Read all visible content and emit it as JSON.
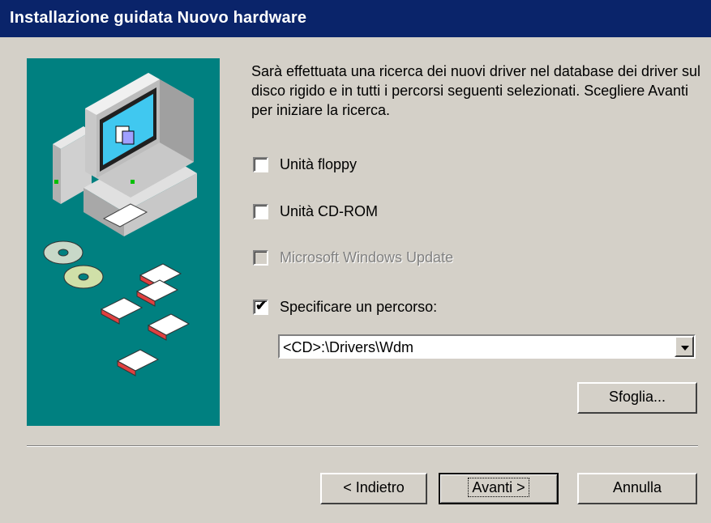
{
  "window": {
    "title": "Installazione guidata Nuovo hardware"
  },
  "description": "Sarà effettuata una ricerca dei nuovi driver nel database dei driver sul disco rigido e in tutti i percorsi seguenti selezionati. Scegliere Avanti per iniziare la ricerca.",
  "options": [
    {
      "label": "Unità floppy",
      "checked": false,
      "enabled": true
    },
    {
      "label": "Unità CD-ROM",
      "checked": false,
      "enabled": true
    },
    {
      "label": "Microsoft Windows Update",
      "checked": false,
      "enabled": false
    },
    {
      "label": "Specificare un percorso:",
      "checked": true,
      "enabled": true
    }
  ],
  "path_combo": {
    "value": "<CD>:\\Drivers\\Wdm"
  },
  "browse_button": {
    "label": "Sfoglia..."
  },
  "nav": {
    "back_label": "< Indietro",
    "next_label": "Avanti >",
    "cancel_label": "Annulla"
  },
  "colors": {
    "titlebar": "#0a246a",
    "face": "#d4d0c8",
    "illustration_bg": "#008080"
  }
}
